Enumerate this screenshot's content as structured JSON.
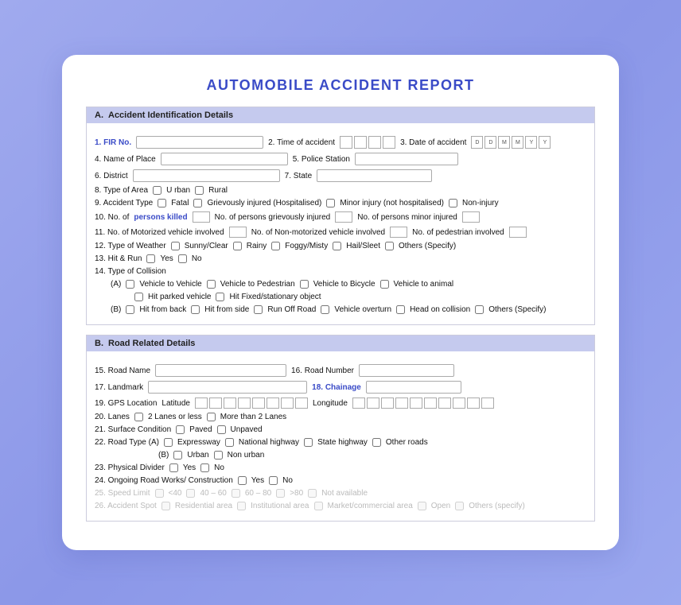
{
  "title": "AUTOMOBILE ACCIDENT REPORT",
  "sectionA": {
    "label": "A.",
    "name": "Accident Identification Details",
    "fields": {
      "firNo": "1. FIR No.",
      "timeOfAccident": "2. Time of accident",
      "dateOfAccident": "3. Date of accident",
      "nameOfPlace": "4. Name of Place",
      "policeStation": "5. Police Station",
      "district": "6. District",
      "state": "7. State",
      "typeOfArea": "8. Type of Area",
      "urban": "U rban",
      "rural": "Rural",
      "accidentType": "9. Accident Type",
      "fatal": "Fatal",
      "grievouslyInjured": "Grievously injured (Hospitalised)",
      "minorInjury": "Minor injury (not hospitalised)",
      "nonInjury": "Non-injury",
      "noPersonsKilled": "10. No. of",
      "personsKilledBlue": "persons killed",
      "noGrievouslyInjured": "No. of persons grievously injured",
      "noPersonsMinorInjured": "No. of  persons minor injured",
      "noMotorizedVehicle": "11. No. of Motorized vehicle involved",
      "noNonMotorized": "No. of Non-motorized vehicle involved",
      "noPedestrian": "No. of pedestrian involved",
      "typeOfWeather": "12. Type of Weather",
      "sunnyClear": "Sunny/Clear",
      "rainy": "Rainy",
      "foggyMisty": "Foggy/Misty",
      "hailSleet": "Hail/Sleet",
      "othersSpecify": "Others (Specify)",
      "hitAndRun": "13. Hit & Run",
      "yes": "Yes",
      "no": "No",
      "typeOfCollision": "14. Type of Collision",
      "collisionA": "(A)",
      "vehicleToVehicle": "Vehicle to Vehicle",
      "vehicleToPedestrian": "Vehicle to Pedestrian",
      "vehicleToBicycle": "Vehicle to Bicycle",
      "vehicleToAnimal": "Vehicle to animal",
      "hitParkedVehicle": "Hit parked vehicle",
      "hitFixedStationary": "Hit Fixed/stationary object",
      "collisionB": "(B)",
      "hitFromBack": "Hit from back",
      "hitFromSide": "Hit from side",
      "runOffRoad": "Run Off Road",
      "vehicleOverturn": "Vehicle overturn",
      "headOnCollision": "Head on collision",
      "othersSpecifyB": "Others (Specify)"
    }
  },
  "sectionB": {
    "label": "B.",
    "name": "Road Related Details",
    "fields": {
      "roadName": "15. Road Name",
      "roadNumber": "16. Road Number",
      "landmark": "17. Landmark",
      "chainage": "18. Chainage",
      "gpsLocation": "19. GPS Location",
      "latitude": "Latitude",
      "longitude": "Longitude",
      "lanes": "20. Lanes",
      "twoLanesOrLess": "2 Lanes or less",
      "moreThan2Lanes": "More than 2 Lanes",
      "surfaceCondition": "21. Surface Condition",
      "paved": "Paved",
      "unpaved": "Unpaved",
      "roadTypeA": "22. Road Type   (A)",
      "expressway": "Expressway",
      "nationalHighway": "National highway",
      "stateHighway": "State highway",
      "otherRoads": "Other roads",
      "roadTypeB": "(B)",
      "urban": "Urban",
      "nonUrban": "Non urban",
      "physicalDivider": "23. Physical Divider",
      "yes": "Yes",
      "no": "No",
      "ongoingRoadWorks": "24. Ongoing Road Works/ Construction",
      "yes2": "Yes",
      "no2": "No",
      "speedLimit": "25. Speed Limit",
      "lt40": "<40",
      "40to60": "40 – 60",
      "60to80": "60 – 80",
      "gt80": ">80",
      "notAvailable": "Not available",
      "accidentSpot": "26. Accident Spot",
      "residentialArea": "Residential area",
      "institutionalArea": "Institutional area",
      "marketCommercialArea": "Market/commercial area",
      "open": "Open",
      "othersSpecify": "Others (specify)"
    }
  }
}
